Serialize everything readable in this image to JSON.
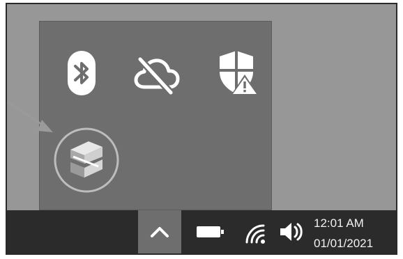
{
  "tray": {
    "icons": [
      {
        "name": "bluetooth-icon"
      },
      {
        "name": "cloud-offline-icon"
      },
      {
        "name": "security-warning-icon"
      },
      {
        "name": "app-logo-icon"
      }
    ]
  },
  "taskbar": {
    "chevron": "show-hidden-icons",
    "clock": {
      "time": "12:01 AM",
      "date": "01/01/2021"
    }
  },
  "colors": {
    "taskbar": "#2b2b2b",
    "flyout": "#6e6e6e",
    "desktop": "#979797",
    "icon": "#ffffff"
  }
}
